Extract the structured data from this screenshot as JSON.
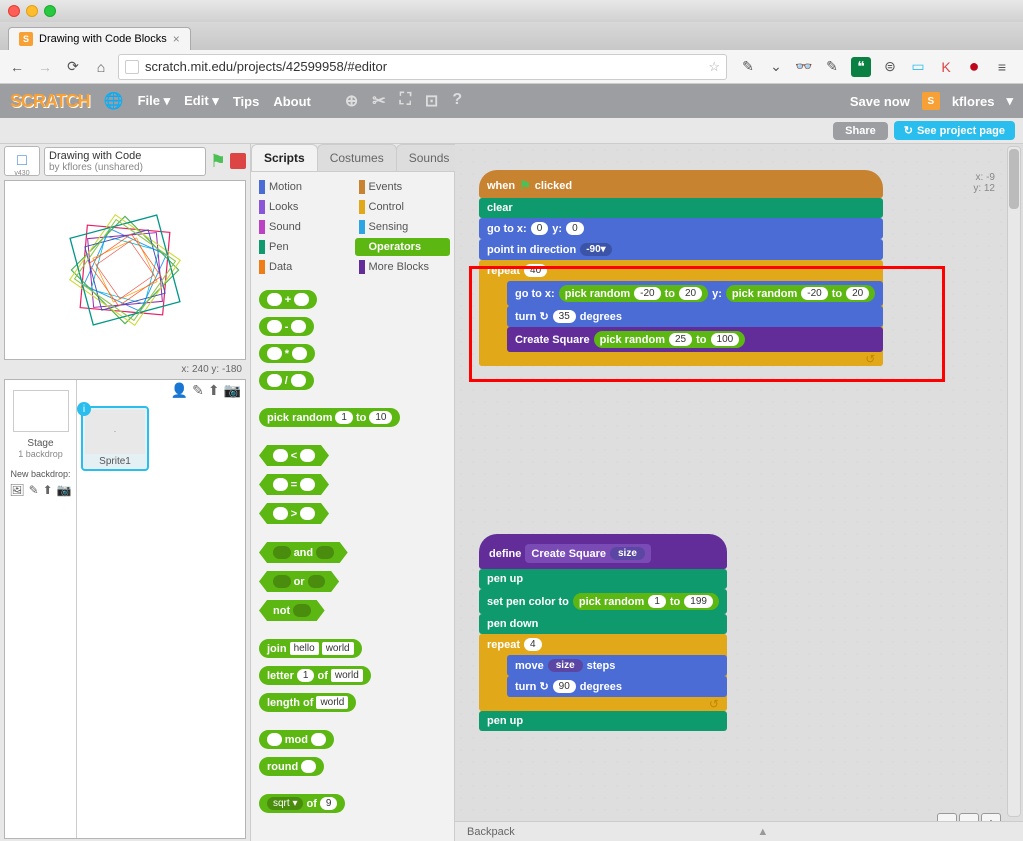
{
  "browser": {
    "tab_title": "Drawing with Code Blocks",
    "url": "scratch.mit.edu/projects/42599958/#editor"
  },
  "menubar": {
    "logo": "SCRATCH",
    "file": "File ▾",
    "edit": "Edit ▾",
    "tips": "Tips",
    "about": "About",
    "save": "Save now",
    "user": "kflores"
  },
  "sharebar": {
    "share": "Share",
    "page": "See project page"
  },
  "project": {
    "title": "Drawing with Code",
    "byline": "by kflores (unshared)",
    "version": "v430",
    "coords": "x: 240   y: -180"
  },
  "sprite_panel": {
    "stage_label": "Stage",
    "backdrop_count": "1 backdrop",
    "new_backdrop": "New backdrop:",
    "sprite1": "Sprite1"
  },
  "tabs": {
    "scripts": "Scripts",
    "costumes": "Costumes",
    "sounds": "Sounds"
  },
  "categories": {
    "motion": "Motion",
    "looks": "Looks",
    "sound": "Sound",
    "pen": "Pen",
    "data": "Data",
    "events": "Events",
    "control": "Control",
    "sensing": "Sensing",
    "operators": "Operators",
    "more": "More Blocks"
  },
  "palette": {
    "pick_random": "pick random",
    "pick_from": "1",
    "pick_to_label": "to",
    "pick_to": "10",
    "and": "and",
    "or": "or",
    "not": "not",
    "join": "join",
    "join_a": "hello",
    "join_b": "world",
    "letter": "letter",
    "letter_n": "1",
    "letter_of": "of",
    "letter_str": "world",
    "length": "length of",
    "length_str": "world",
    "mod": "mod",
    "round": "round",
    "sqrt": "sqrt ▾",
    "sqrt_of": "of",
    "sqrt_n": "9"
  },
  "script1": {
    "when_clicked": "when",
    "clicked": "clicked",
    "clear": "clear",
    "gotoxy": "go to x:",
    "goto_x": "0",
    "goto_y_lbl": "y:",
    "goto_y": "0",
    "point_dir": "point in direction",
    "dir_val": "-90▾",
    "repeat": "repeat",
    "repeat_n": "40",
    "goto2": "go to x:",
    "pr": "pick random",
    "pr_a1": "-20",
    "pr_to": "to",
    "pr_b1": "20",
    "goto2_y": "y:",
    "pr_a2": "-20",
    "pr_b2": "20",
    "turn": "turn ↻",
    "turn_deg": "35",
    "degrees": "degrees",
    "create_sq": "Create Square",
    "pr_c1": "25",
    "pr_c2": "100"
  },
  "script2": {
    "define": "define",
    "create_sq": "Create Square",
    "size": "size",
    "pen_up": "pen up",
    "set_pen": "set pen color to",
    "pr": "pick random",
    "pr_a": "1",
    "pr_to": "to",
    "pr_b": "199",
    "pen_down": "pen down",
    "repeat": "repeat",
    "repeat_n": "4",
    "move": "move",
    "steps": "steps",
    "turn": "turn ↻",
    "turn_n": "90",
    "degrees": "degrees",
    "pen_up2": "pen up"
  },
  "stage_coords": {
    "x": "x: -9",
    "y": "y: 12"
  },
  "backpack": "Backpack"
}
